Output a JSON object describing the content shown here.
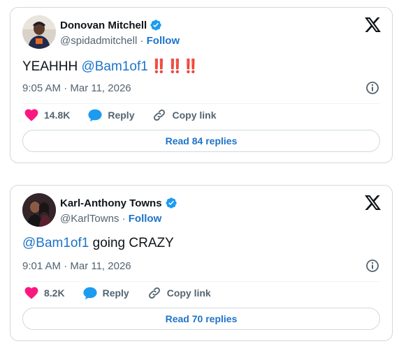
{
  "tweets": [
    {
      "display_name": "Donovan Mitchell",
      "handle": "@spidadmitchell",
      "separator": "·",
      "follow_label": "Follow",
      "text_prefix": "YEAHHH ",
      "mention": "@Bam1of1",
      "text_suffix": "",
      "emphasis": "‼️‼️‼️",
      "timestamp": "9:05 AM · Mar 11, 2026",
      "likes": "14.8K",
      "reply_label": "Reply",
      "copy_link_label": "Copy link",
      "read_replies_label": "Read 84 replies",
      "avatar_icon": "avatar-photo",
      "verified": true
    },
    {
      "display_name": "Karl-Anthony Towns",
      "handle": "@KarlTowns",
      "separator": "·",
      "follow_label": "Follow",
      "text_prefix": "",
      "mention": "@Bam1of1",
      "text_suffix": " going CRAZY",
      "emphasis": "",
      "timestamp": "9:01 AM · Mar 11, 2026",
      "likes": "8.2K",
      "reply_label": "Reply",
      "copy_link_label": "Copy link",
      "read_replies_label": "Read 70 replies",
      "avatar_icon": "avatar-photo",
      "verified": true
    }
  ],
  "colors": {
    "link": "#1d73c9",
    "heart": "#f91880",
    "verified": "#1d9bf0",
    "muted": "#536471",
    "border": "#cfd9de",
    "emphasis": "#d72631"
  }
}
